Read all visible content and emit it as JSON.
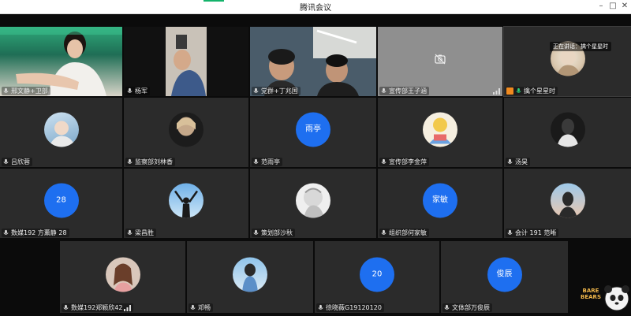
{
  "window": {
    "title": "腾讯会议",
    "controls": {
      "minimize": "–",
      "maximize": "□",
      "close": "✕"
    }
  },
  "tiles": [
    {
      "name": "邢文静+卫部"
    },
    {
      "name": "杨军"
    },
    {
      "name": "党群+丁兆国"
    },
    {
      "name": "宣传部王子涵"
    },
    {
      "name": "擒个星星时"
    },
    {
      "name": "吕欣蓉"
    },
    {
      "name": "监察部刘林香"
    },
    {
      "name": "范雨亭",
      "avatar_text": "雨亭"
    },
    {
      "name": "宣传部李金萍"
    },
    {
      "name": "汤昊"
    },
    {
      "name": "数媒192 方薰静 28",
      "avatar_text": "28"
    },
    {
      "name": "梁昌胜"
    },
    {
      "name": "策划部沙秋"
    },
    {
      "name": "组织部何家敏",
      "avatar_text": "家敏"
    },
    {
      "name": "会计 191 范晰"
    },
    {
      "name": "数媒192郑颖欣42"
    },
    {
      "name": "邓畅"
    },
    {
      "name": "徐晓薇G19120120",
      "avatar_text": "20"
    },
    {
      "name": "文体部万俊辰",
      "avatar_text": "俊辰"
    }
  ],
  "speaking_bubble": "正在讲话：擒个星星时",
  "sticker_text": "BARE BEARS",
  "colors": {
    "avatar_blue": "#1e6ff0",
    "tile_bg": "#2b2b2b",
    "accent_green": "#14b36b"
  }
}
